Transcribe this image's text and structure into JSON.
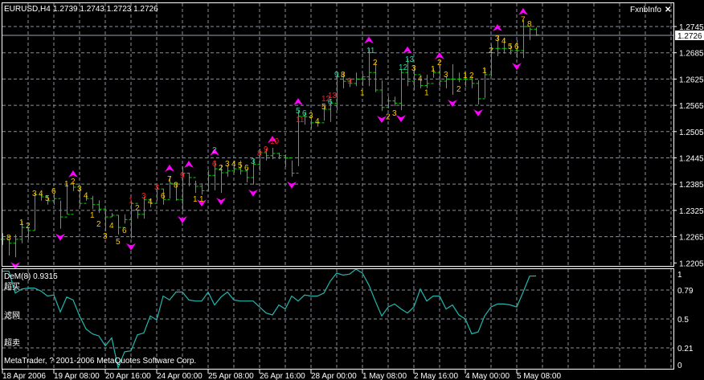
{
  "header": {
    "symbol": "EURUSD,H4",
    "ohlc": "1.2739 1.2743 1.2723 1.2726",
    "panel_title": "FxnbInfo",
    "close_icon": "close-icon"
  },
  "colors": {
    "background": "#000000",
    "bars": "#00dd00",
    "arrows": "#ff00ff",
    "label_yellow": "#ffc800",
    "label_red": "#ff2020",
    "label_cyan": "#20e0a0",
    "indicator_line": "#20b8b0",
    "grid": "#8a9098",
    "axis": "#ffffff"
  },
  "price_axis": {
    "labels": [
      "1.2745",
      "1.2685",
      "1.2625",
      "1.2565",
      "1.2505",
      "1.2445",
      "1.2385",
      "1.2325",
      "1.2265",
      "1.2205"
    ],
    "current_price": "1.2726"
  },
  "time_axis": {
    "labels": [
      "18 Apr 2006",
      "19 Apr 08:00",
      "20 Apr 16:00",
      "24 Apr 00:00",
      "25 Apr 08:00",
      "26 Apr 16:00",
      "28 Apr 00:00",
      "1 May 08:00",
      "2 May 16:00",
      "4 May 00:00",
      "5 May 08:00"
    ]
  },
  "indicator": {
    "title": "DeM(8) 0.9315",
    "level_labels": [
      "超买",
      "滤网",
      "超卖"
    ],
    "axis_labels": [
      "1",
      "0.79",
      "0.5",
      "0.21",
      "0"
    ],
    "copyright": "MetaTrader, ? 2001-2006 MetaQuotes Software Corp."
  },
  "chart_data": [
    {
      "type": "ohlc",
      "symbol": "EURUSD",
      "timeframe": "H4",
      "ylim": [
        1.2205,
        1.276
      ],
      "grid": true,
      "current_price": 1.2726,
      "bars_hlc": [
        [
          1.2273,
          1.2246,
          1.2259
        ],
        [
          1.2259,
          1.2222,
          1.225
        ],
        [
          1.227,
          1.2218,
          1.2259
        ],
        [
          1.2301,
          1.225,
          1.2286
        ],
        [
          1.2286,
          1.2259,
          1.2279
        ],
        [
          1.2365,
          1.2279,
          1.2361
        ],
        [
          1.2365,
          1.2347,
          1.2356
        ],
        [
          1.2358,
          1.2338,
          1.2347
        ],
        [
          1.2365,
          1.2338,
          1.2352
        ],
        [
          1.2347,
          1.2283,
          1.231
        ],
        [
          1.2387,
          1.2316,
          1.2316
        ],
        [
          1.2389,
          1.2369,
          1.2378
        ],
        [
          1.2378,
          1.2334,
          1.2341
        ],
        [
          1.236,
          1.2347,
          1.2352
        ],
        [
          1.2358,
          1.2328,
          1.2338
        ],
        [
          1.2348,
          1.2319,
          1.2328
        ],
        [
          1.2328,
          1.2277,
          1.231
        ],
        [
          1.2319,
          1.231,
          1.2314
        ],
        [
          1.2314,
          1.227,
          1.2286
        ],
        [
          1.2316,
          1.2295,
          1.2304
        ],
        [
          1.2347,
          1.2261,
          1.2341
        ],
        [
          1.2325,
          1.2306,
          1.2316
        ],
        [
          1.2356,
          1.2306,
          1.235
        ],
        [
          1.2352,
          1.2332,
          1.2341
        ],
        [
          1.2378,
          1.2347,
          1.2374
        ],
        [
          1.2374,
          1.2338,
          1.235
        ],
        [
          1.2402,
          1.2352,
          1.2387
        ],
        [
          1.2387,
          1.2347,
          1.235
        ],
        [
          1.2426,
          1.2323,
          1.241
        ],
        [
          1.2411,
          1.238,
          1.24
        ],
        [
          1.2393,
          1.2365,
          1.238
        ],
        [
          1.2387,
          1.2361,
          1.237
        ],
        [
          1.2417,
          1.2369,
          1.2405
        ],
        [
          1.2439,
          1.2371,
          1.242
        ],
        [
          1.2429,
          1.2365,
          1.2411
        ],
        [
          1.2429,
          1.2402,
          1.2415
        ],
        [
          1.2429,
          1.2411,
          1.242
        ],
        [
          1.2439,
          1.2407,
          1.2415
        ],
        [
          1.242,
          1.2389,
          1.24
        ],
        [
          1.2442,
          1.2384,
          1.243
        ],
        [
          1.2466,
          1.2415,
          1.2457
        ],
        [
          1.2466,
          1.2439,
          1.245
        ],
        [
          1.2468,
          1.2442,
          1.2455
        ],
        [
          1.2457,
          1.2442,
          1.245
        ],
        [
          1.2453,
          1.2424,
          1.2445
        ],
        [
          1.2439,
          1.2402,
          1.241
        ],
        [
          1.2554,
          1.2426,
          1.254
        ],
        [
          1.2549,
          1.2521,
          1.2539
        ],
        [
          1.2536,
          1.2512,
          1.2525
        ],
        [
          1.253,
          1.2516,
          1.2525
        ],
        [
          1.2562,
          1.253,
          1.2556
        ],
        [
          1.258,
          1.2527,
          1.257
        ],
        [
          1.2635,
          1.2554,
          1.263
        ],
        [
          1.264,
          1.2604,
          1.262
        ],
        [
          1.2628,
          1.2607,
          1.2615
        ],
        [
          1.264,
          1.2609,
          1.2625
        ],
        [
          1.2637,
          1.2609,
          1.263
        ],
        [
          1.2695,
          1.2609,
          1.264
        ],
        [
          1.2664,
          1.2595,
          1.26
        ],
        [
          1.2622,
          1.2552,
          1.256
        ],
        [
          1.2585,
          1.2558,
          1.2575
        ],
        [
          1.2585,
          1.2563,
          1.257
        ],
        [
          1.2646,
          1.2554,
          1.264
        ],
        [
          1.2672,
          1.2609,
          1.262
        ],
        [
          1.2653,
          1.26,
          1.2635
        ],
        [
          1.2622,
          1.2604,
          1.261
        ],
        [
          1.2635,
          1.2604,
          1.2615
        ],
        [
          1.265,
          1.2628,
          1.264
        ],
        [
          1.2659,
          1.2607,
          1.262
        ],
        [
          1.2631,
          1.2604,
          1.2625
        ],
        [
          1.2659,
          1.2589,
          1.2625
        ],
        [
          1.264,
          1.2618,
          1.2625
        ],
        [
          1.264,
          1.2607,
          1.2625
        ],
        [
          1.2631,
          1.2604,
          1.2615
        ],
        [
          1.2622,
          1.2567,
          1.258
        ],
        [
          1.265,
          1.2582,
          1.2635
        ],
        [
          1.2705,
          1.2631,
          1.2695
        ],
        [
          1.2723,
          1.2677,
          1.2695
        ],
        [
          1.2717,
          1.2683,
          1.2695
        ],
        [
          1.2705,
          1.2681,
          1.269
        ],
        [
          1.2714,
          1.2673,
          1.269
        ],
        [
          1.276,
          1.2673,
          1.2745
        ],
        [
          1.2743,
          1.2714,
          1.2739
        ],
        [
          1.2743,
          1.2723,
          1.2726
        ]
      ],
      "up_arrows_at_bar": [
        11,
        26,
        29,
        33,
        42,
        46,
        57,
        63,
        68,
        77,
        81
      ],
      "down_arrows_at_bar": [
        2,
        9,
        20,
        28,
        31,
        34,
        39,
        45,
        59,
        62,
        70,
        74,
        80
      ],
      "labels": [
        [
          1,
          1.2264,
          "8",
          "y"
        ],
        [
          3,
          1.2299,
          "1",
          "y"
        ],
        [
          4,
          1.2292,
          "2",
          "y"
        ],
        [
          5,
          1.2365,
          "3",
          "y"
        ],
        [
          6,
          1.2365,
          "4",
          "y"
        ],
        [
          7,
          1.2354,
          "5",
          "y"
        ],
        [
          8,
          1.2371,
          "6",
          "y"
        ],
        [
          10,
          1.2387,
          "1",
          "y"
        ],
        [
          11,
          1.2393,
          "2",
          "y"
        ],
        [
          12,
          1.2376,
          "3",
          "y"
        ],
        [
          13,
          1.2361,
          "4",
          "y"
        ],
        [
          14,
          1.2316,
          "1",
          "y"
        ],
        [
          15,
          1.2295,
          "2",
          "y"
        ],
        [
          16,
          1.2268,
          "3",
          "y"
        ],
        [
          17,
          1.2292,
          "4",
          "y"
        ],
        [
          18,
          1.2255,
          "5",
          "y"
        ],
        [
          19,
          1.2281,
          "6",
          "y"
        ],
        [
          20,
          1.235,
          "1",
          "r"
        ],
        [
          21,
          1.2332,
          "2",
          "y"
        ],
        [
          22,
          1.236,
          "3",
          "r"
        ],
        [
          23,
          1.2347,
          "4",
          "y"
        ],
        [
          24,
          1.238,
          "3",
          "r"
        ],
        [
          25,
          1.236,
          "6",
          "y"
        ],
        [
          26,
          1.2398,
          "7",
          "y"
        ],
        [
          27,
          1.2384,
          "8",
          "y"
        ],
        [
          28,
          1.2406,
          "9",
          "r"
        ],
        [
          30,
          1.2352,
          "1",
          "y"
        ],
        [
          31,
          1.2352,
          "1",
          "y"
        ],
        [
          33,
          1.2433,
          "6",
          "r"
        ],
        [
          33,
          1.2464,
          "2",
          "c"
        ],
        [
          34,
          1.2424,
          "2",
          "y"
        ],
        [
          35,
          1.2433,
          "3",
          "y"
        ],
        [
          36,
          1.2433,
          "4",
          "y"
        ],
        [
          37,
          1.2429,
          "5",
          "y"
        ],
        [
          38,
          1.2424,
          "6",
          "y"
        ],
        [
          39,
          1.2439,
          "3",
          "c"
        ],
        [
          40,
          1.2457,
          "8",
          "r"
        ],
        [
          41,
          1.2466,
          "9",
          "r"
        ],
        [
          42,
          1.2484,
          "10",
          "r"
        ],
        [
          46,
          1.2534,
          "11",
          "r"
        ],
        [
          46,
          1.2554,
          "5",
          "c"
        ],
        [
          47,
          1.2549,
          "6",
          "c"
        ],
        [
          48,
          1.2543,
          "3",
          "y"
        ],
        [
          49,
          1.253,
          "4",
          "y"
        ],
        [
          50,
          1.2563,
          "5",
          "y"
        ],
        [
          50,
          1.2582,
          "12",
          "r"
        ],
        [
          51,
          1.2589,
          "13",
          "r"
        ],
        [
          51,
          1.2574,
          "6",
          "c"
        ],
        [
          52,
          1.2637,
          "9",
          "c"
        ],
        [
          53,
          1.2637,
          "8",
          "y"
        ],
        [
          54,
          1.2622,
          "9",
          "r"
        ],
        [
          56,
          1.2595,
          "1",
          "y"
        ],
        [
          57,
          1.2692,
          "11",
          "c"
        ],
        [
          58,
          1.2664,
          "2",
          "y"
        ],
        [
          60,
          1.254,
          "2",
          "y"
        ],
        [
          61,
          1.2549,
          "3",
          "y"
        ],
        [
          62,
          1.2653,
          "12",
          "c"
        ],
        [
          63,
          1.2672,
          "13",
          "c"
        ],
        [
          64,
          1.2651,
          "3",
          "y"
        ],
        [
          65,
          1.2628,
          "4",
          "y"
        ],
        [
          66,
          1.2595,
          "1",
          "y"
        ],
        [
          67,
          1.265,
          "1",
          "y"
        ],
        [
          68,
          1.2664,
          "2",
          "y"
        ],
        [
          69,
          1.2637,
          "3",
          "y"
        ],
        [
          71,
          1.2604,
          "2",
          "y"
        ],
        [
          72,
          1.2635,
          "1",
          "y"
        ],
        [
          73,
          1.2635,
          "2",
          "y"
        ],
        [
          75,
          1.2646,
          "1",
          "y"
        ],
        [
          76,
          1.2692,
          "2",
          "y"
        ],
        [
          77,
          1.2719,
          "3",
          "y"
        ],
        [
          78,
          1.2714,
          "4",
          "y"
        ],
        [
          79,
          1.2701,
          "5",
          "y"
        ],
        [
          80,
          1.2701,
          "6",
          "y"
        ],
        [
          81,
          1.2762,
          "7",
          "y"
        ],
        [
          82,
          1.2752,
          "8",
          "y"
        ]
      ]
    },
    {
      "type": "line",
      "name": "DeM(8)",
      "ylim": [
        0,
        1
      ],
      "levels": [
        0.79,
        0.5,
        0.21
      ],
      "values": [
        0.98,
        0.98,
        0.76,
        0.8,
        0.81,
        0.81,
        0.78,
        0.73,
        0.74,
        0.57,
        0.72,
        0.69,
        0.53,
        0.4,
        0.35,
        0.33,
        0.23,
        0.31,
        0.01,
        0.17,
        0.18,
        0.34,
        0.36,
        0.53,
        0.49,
        0.73,
        0.69,
        0.77,
        0.77,
        0.69,
        0.68,
        0.68,
        0.77,
        0.64,
        0.72,
        0.77,
        0.69,
        0.68,
        0.68,
        0.68,
        0.62,
        0.56,
        0.54,
        0.64,
        0.6,
        0.73,
        0.68,
        0.74,
        0.73,
        0.73,
        0.76,
        0.88,
        0.96,
        0.94,
        0.95,
        1.0,
        0.96,
        0.84,
        0.68,
        0.53,
        0.62,
        0.65,
        0.6,
        0.56,
        0.62,
        0.8,
        0.68,
        0.73,
        0.73,
        0.6,
        0.64,
        0.54,
        0.5,
        0.35,
        0.37,
        0.53,
        0.62,
        0.65,
        0.65,
        0.64,
        0.62,
        0.77,
        0.93,
        0.9315
      ]
    }
  ]
}
